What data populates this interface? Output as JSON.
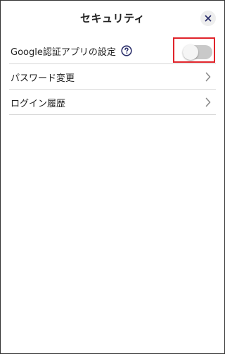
{
  "header": {
    "title": "セキュリティ"
  },
  "rows": {
    "google_auth": {
      "label": "Google認証アプリの設定",
      "toggle_on": false
    },
    "password_change": {
      "label": "パスワード変更"
    },
    "login_history": {
      "label": "ログイン履歴"
    }
  },
  "colors": {
    "highlight_border": "#e0242b",
    "toggle_off_track": "#c9c9c9",
    "help_icon": "#2b2f6b",
    "close_icon": "#2b2f6b"
  },
  "icons": {
    "close": "close-icon",
    "help": "question-circle-icon",
    "chevron": "chevron-right-icon"
  }
}
